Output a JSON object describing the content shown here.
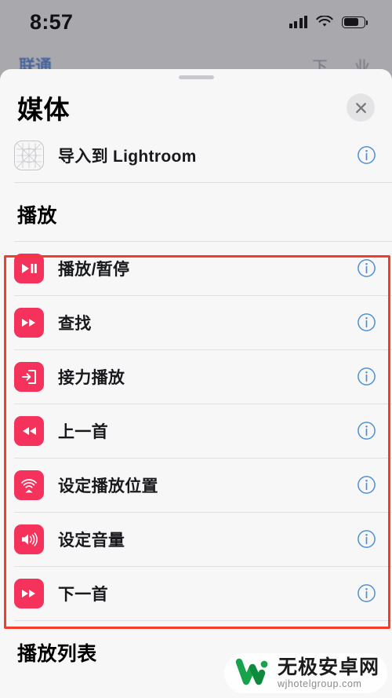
{
  "status_bar": {
    "time": "8:57",
    "signal_icon": "cellular-signal-icon",
    "wifi_icon": "wifi-icon",
    "battery_icon": "battery-icon"
  },
  "background_app": {
    "left_text": "联通",
    "right_items": [
      "下",
      "业"
    ]
  },
  "sheet": {
    "grabber": "drag-handle",
    "title": "媒体",
    "close_label": "×",
    "top_rows": [
      {
        "label": "导入到 Lightroom",
        "icon": "app-placeholder-icon",
        "icon_style": "placeholder",
        "info": "info-button"
      }
    ],
    "sections": [
      {
        "heading": "播放",
        "highlighted": true,
        "rows": [
          {
            "label": "播放/暂停",
            "icon": "play-pause-icon",
            "info": "info-button"
          },
          {
            "label": "查找",
            "icon": "fast-forward-icon",
            "info": "info-button"
          },
          {
            "label": "接力播放",
            "icon": "handoff-icon",
            "info": "info-button"
          },
          {
            "label": "上一首",
            "icon": "rewind-icon",
            "info": "info-button"
          },
          {
            "label": "设定播放位置",
            "icon": "airplay-audio-icon",
            "info": "info-button"
          },
          {
            "label": "设定音量",
            "icon": "speaker-volume-icon",
            "info": "info-button"
          },
          {
            "label": "下一首",
            "icon": "fast-forward-icon",
            "info": "info-button"
          }
        ]
      },
      {
        "heading": "播放列表",
        "highlighted": false,
        "rows": []
      }
    ]
  },
  "annotation": {
    "highlight_color": "#f43c2c"
  },
  "watermark": {
    "site_name": "无极安卓网",
    "url": "wjhotelgroup.com",
    "logo": "wj-logo",
    "color": "#17a34a"
  },
  "colors": {
    "accent_red": "#f4325c",
    "info_blue": "#4a90d9",
    "sheet_bg": "#f7f7f8",
    "backdrop": "#a9a8ad"
  }
}
